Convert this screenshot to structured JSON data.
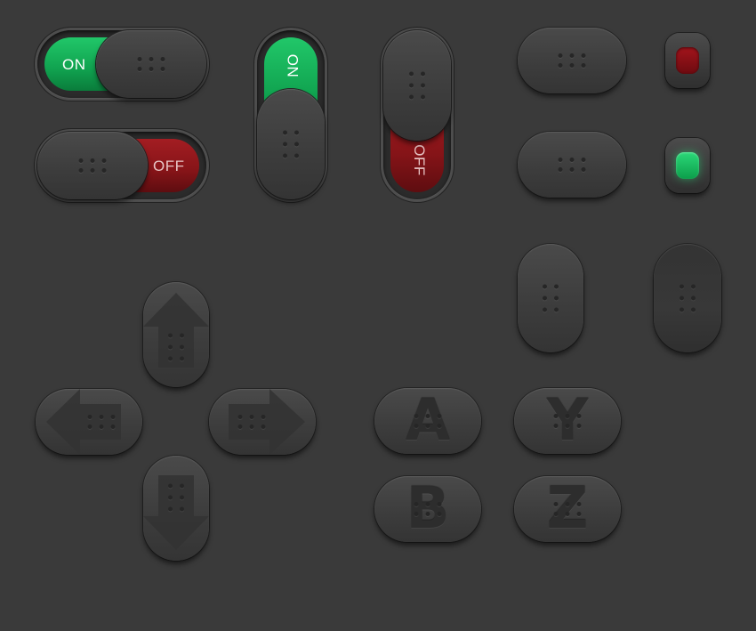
{
  "toggles": {
    "h_on_label": "ON",
    "h_off_label": "OFF",
    "v_on_label": "ON",
    "v_off_label": "OFF"
  },
  "leds": {
    "top_color": "#8b0f16",
    "bottom_color": "#1fcf6f"
  },
  "dpad": {
    "up": "up-arrow-icon",
    "down": "down-arrow-icon",
    "left": "left-arrow-icon",
    "right": "right-arrow-icon"
  },
  "face_buttons": {
    "a": "A",
    "b": "B",
    "y": "Y",
    "z": "Z"
  },
  "colors": {
    "background": "#3a3a3a",
    "on": "#14b05a",
    "off": "#8a1419"
  }
}
